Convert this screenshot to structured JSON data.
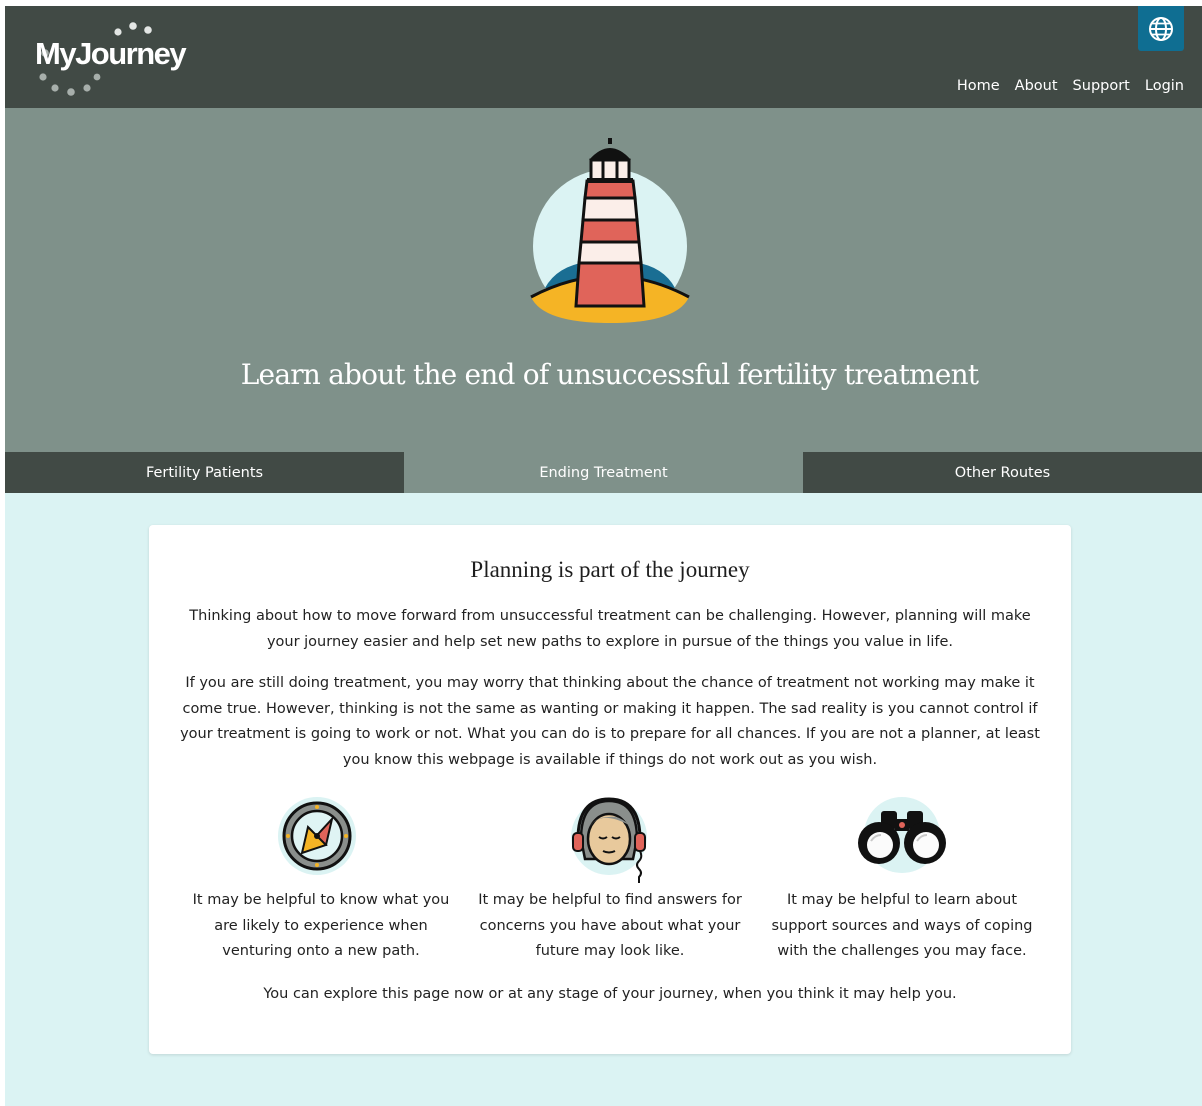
{
  "header": {
    "logo_text": "MyJourney",
    "nav": [
      "Home",
      "About",
      "Support",
      "Login"
    ],
    "language_icon": "globe-icon"
  },
  "hero": {
    "title": "Learn about the end of unsuccessful fertility treatment",
    "illustration": "lighthouse-illustration"
  },
  "tabs": [
    {
      "label": "Fertility Patients",
      "active": false
    },
    {
      "label": "Ending Treatment",
      "active": true
    },
    {
      "label": "Other Routes",
      "active": false
    }
  ],
  "card": {
    "title": "Planning is part of the journey",
    "paragraph1": "Thinking about how to move forward from unsuccessful treatment can be challenging. However, planning will make your journey easier and help set new paths to explore in pursue of the things you value in life.",
    "paragraph2": "If you are still doing treatment, you may worry that thinking about the chance of treatment not working may make it come true. However, thinking is not the same as wanting or making it happen. The sad reality is you cannot control if your treatment is going to work or not. What you can do is to prepare for all chances. If you are not a planner, at least you know this webpage is available if things do not work out as you wish.",
    "features": [
      {
        "icon": "compass-icon",
        "text": "It may be helpful to know what you are likely to experience when venturing onto a new path."
      },
      {
        "icon": "person-headphones-icon",
        "text": "It may be helpful to find answers for concerns you have about what your future may look like."
      },
      {
        "icon": "binoculars-icon",
        "text": "It may be helpful to learn about support sources and ways of coping with the challenges you may face."
      }
    ],
    "closing": "You can explore this page now or at any stage of your journey, when you think it may help you."
  },
  "colors": {
    "header_bg": "#414a45",
    "hero_bg": "#7f918a",
    "content_bg": "#dbf3f3",
    "globe_button": "#0f6e92"
  }
}
